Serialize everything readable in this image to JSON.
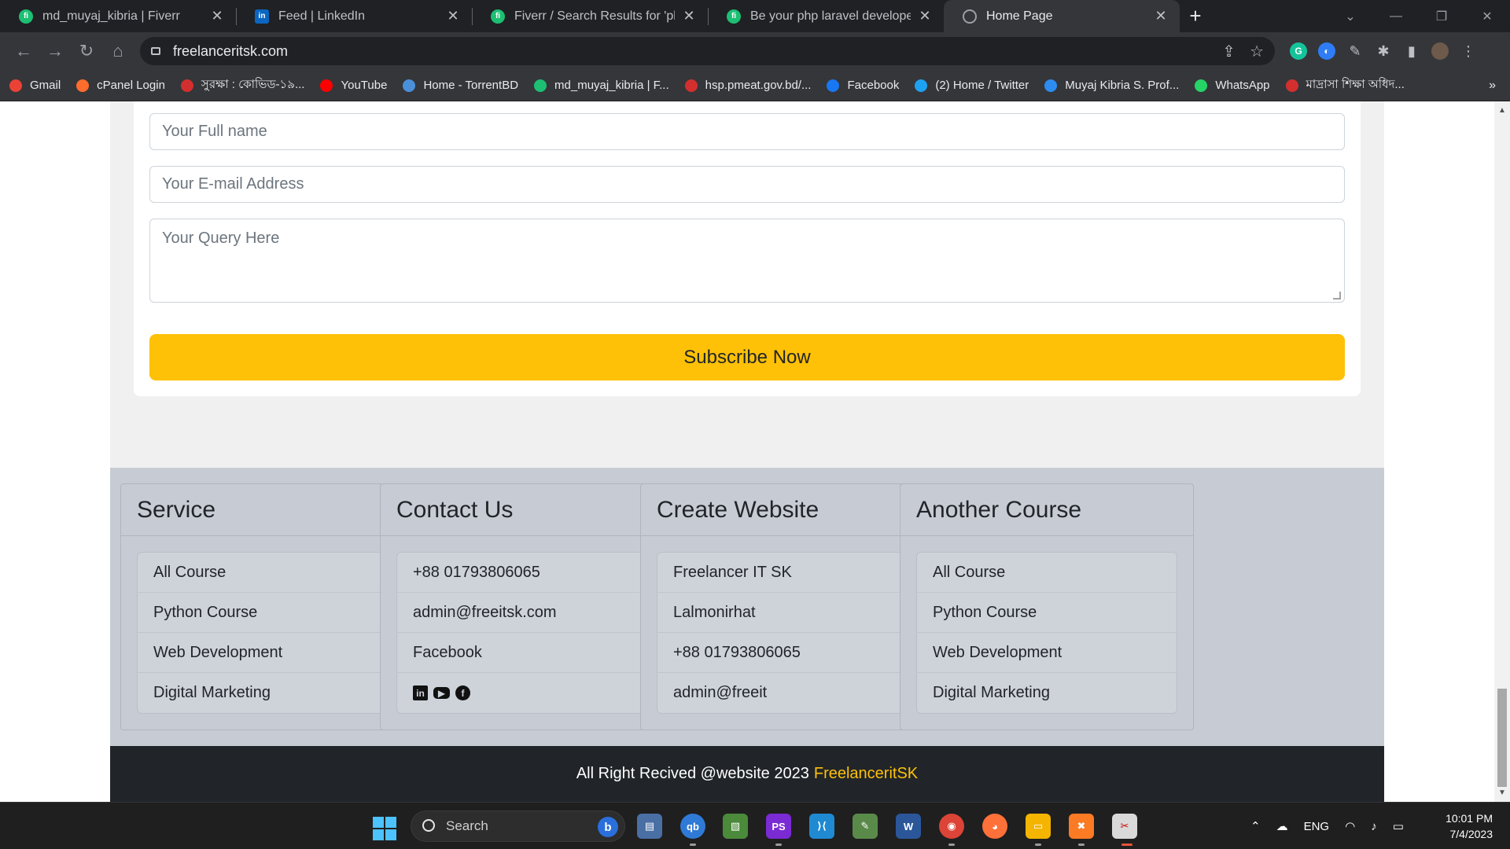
{
  "browser": {
    "tabs": [
      {
        "title": "md_muyaj_kibria | Fiverr",
        "icon": "fiverr-icon",
        "active": false
      },
      {
        "title": "Feed | LinkedIn",
        "icon": "linkedin-icon",
        "active": false
      },
      {
        "title": "Fiverr / Search Results for 'php la",
        "icon": "fiverr-icon",
        "active": false
      },
      {
        "title": "Be your php laravel developer an",
        "icon": "fiverr-icon",
        "active": false
      },
      {
        "title": "Home Page",
        "icon": "globe-icon",
        "active": true
      }
    ],
    "url": "freelanceritsk.com",
    "bookmarks": [
      {
        "label": "Gmail",
        "color": "#ea4335"
      },
      {
        "label": "cPanel Login",
        "color": "#ff6c2c"
      },
      {
        "label": "সুরক্ষা : কোভিড-১৯...",
        "color": "#d32f2f"
      },
      {
        "label": "YouTube",
        "color": "#ff0000"
      },
      {
        "label": "Home - TorrentBD",
        "color": "#4a90d9"
      },
      {
        "label": "md_muyaj_kibria | F...",
        "color": "#1dbf73"
      },
      {
        "label": "hsp.pmeat.gov.bd/...",
        "color": "#d32f2f"
      },
      {
        "label": "Facebook",
        "color": "#1877f2"
      },
      {
        "label": "(2) Home / Twitter",
        "color": "#1da1f2"
      },
      {
        "label": "Muyaj Kibria S. Prof...",
        "color": "#2d8cf0"
      },
      {
        "label": "WhatsApp",
        "color": "#25d366"
      },
      {
        "label": "মাদ্রাসা শিক্ষা অধিদ...",
        "color": "#d32f2f"
      }
    ],
    "more_bookmarks": "»"
  },
  "form": {
    "name_placeholder": "Your Full name",
    "email_placeholder": "Your E-mail Address",
    "query_placeholder": "Your Query Here",
    "submit_label": "Subscribe Now"
  },
  "footer": {
    "columns": [
      {
        "title": "Service",
        "items": [
          "All Course",
          "Python Course",
          "Web Development",
          "Digital Marketing"
        ]
      },
      {
        "title": "Contact Us",
        "items": [
          "+88 01793806065",
          "admin@freeitsk.com",
          "Facebook"
        ],
        "social": [
          "linkedin-icon",
          "youtube-icon",
          "facebook-icon"
        ]
      },
      {
        "title": "Create Website",
        "items": [
          "Freelancer IT SK",
          "Lalmonirhat",
          "+88 01793806065",
          "admin@freeit"
        ]
      },
      {
        "title": "Another Course",
        "items": [
          "All Course",
          "Python Course",
          "Web Development",
          "Digital Marketing"
        ]
      }
    ],
    "copyright": "All Right Recived @website 2023",
    "brand": "FreelanceritSK"
  },
  "taskbar": {
    "search_label": "Search",
    "tray": {
      "language": "ENG",
      "time": "10:01 PM",
      "date": "7/4/2023"
    }
  },
  "colors": {
    "accent": "#ffc107",
    "footer_bg": "#212529",
    "footer_columns_bg": "#c7ccd4"
  }
}
